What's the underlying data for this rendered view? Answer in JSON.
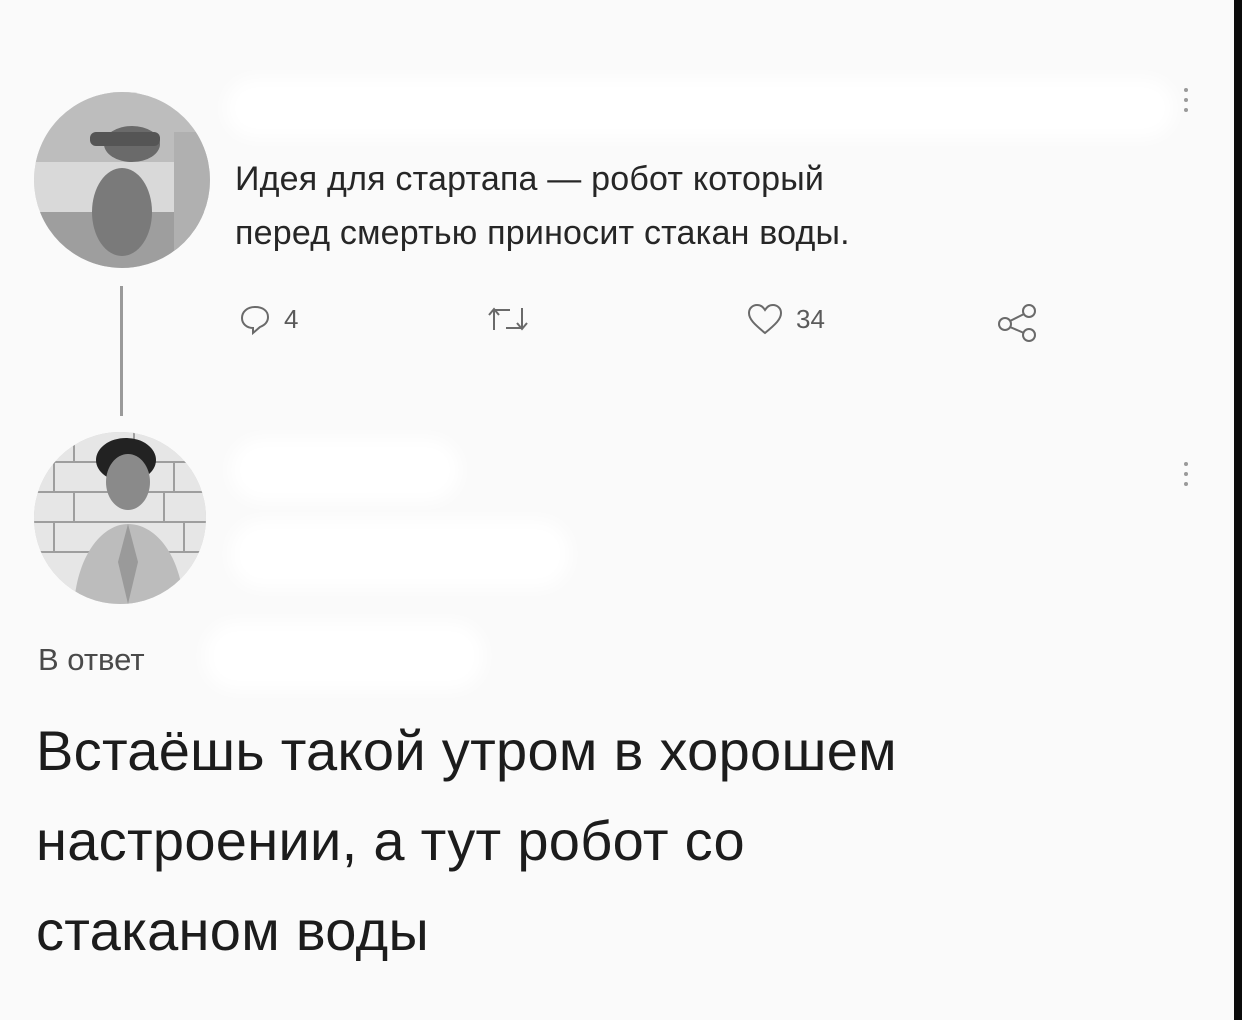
{
  "first_tweet": {
    "avatar": "user-avatar-photo",
    "text_lines": [
      "Идея для стартапа — робот который",
      "перед смертью приносит стакан воды."
    ],
    "actions": {
      "reply": {
        "icon": "comment-icon",
        "count": "4"
      },
      "retweet": {
        "icon": "retweet-icon"
      },
      "like": {
        "icon": "heart-icon",
        "count": "34"
      },
      "share": {
        "icon": "share-icon"
      }
    },
    "more_icon": "more-vertical-icon"
  },
  "reply_tweet": {
    "avatar": "user-avatar-photo",
    "reply_label": "В ответ",
    "text_lines": [
      "Встаёшь такой утром в хорошем",
      "настроении, а тут робот со",
      "стаканом воды"
    ],
    "more_icon": "more-vertical-icon"
  },
  "colors": {
    "background": "#fafafa",
    "text": "#222222",
    "icons": "#5a5a5a"
  }
}
